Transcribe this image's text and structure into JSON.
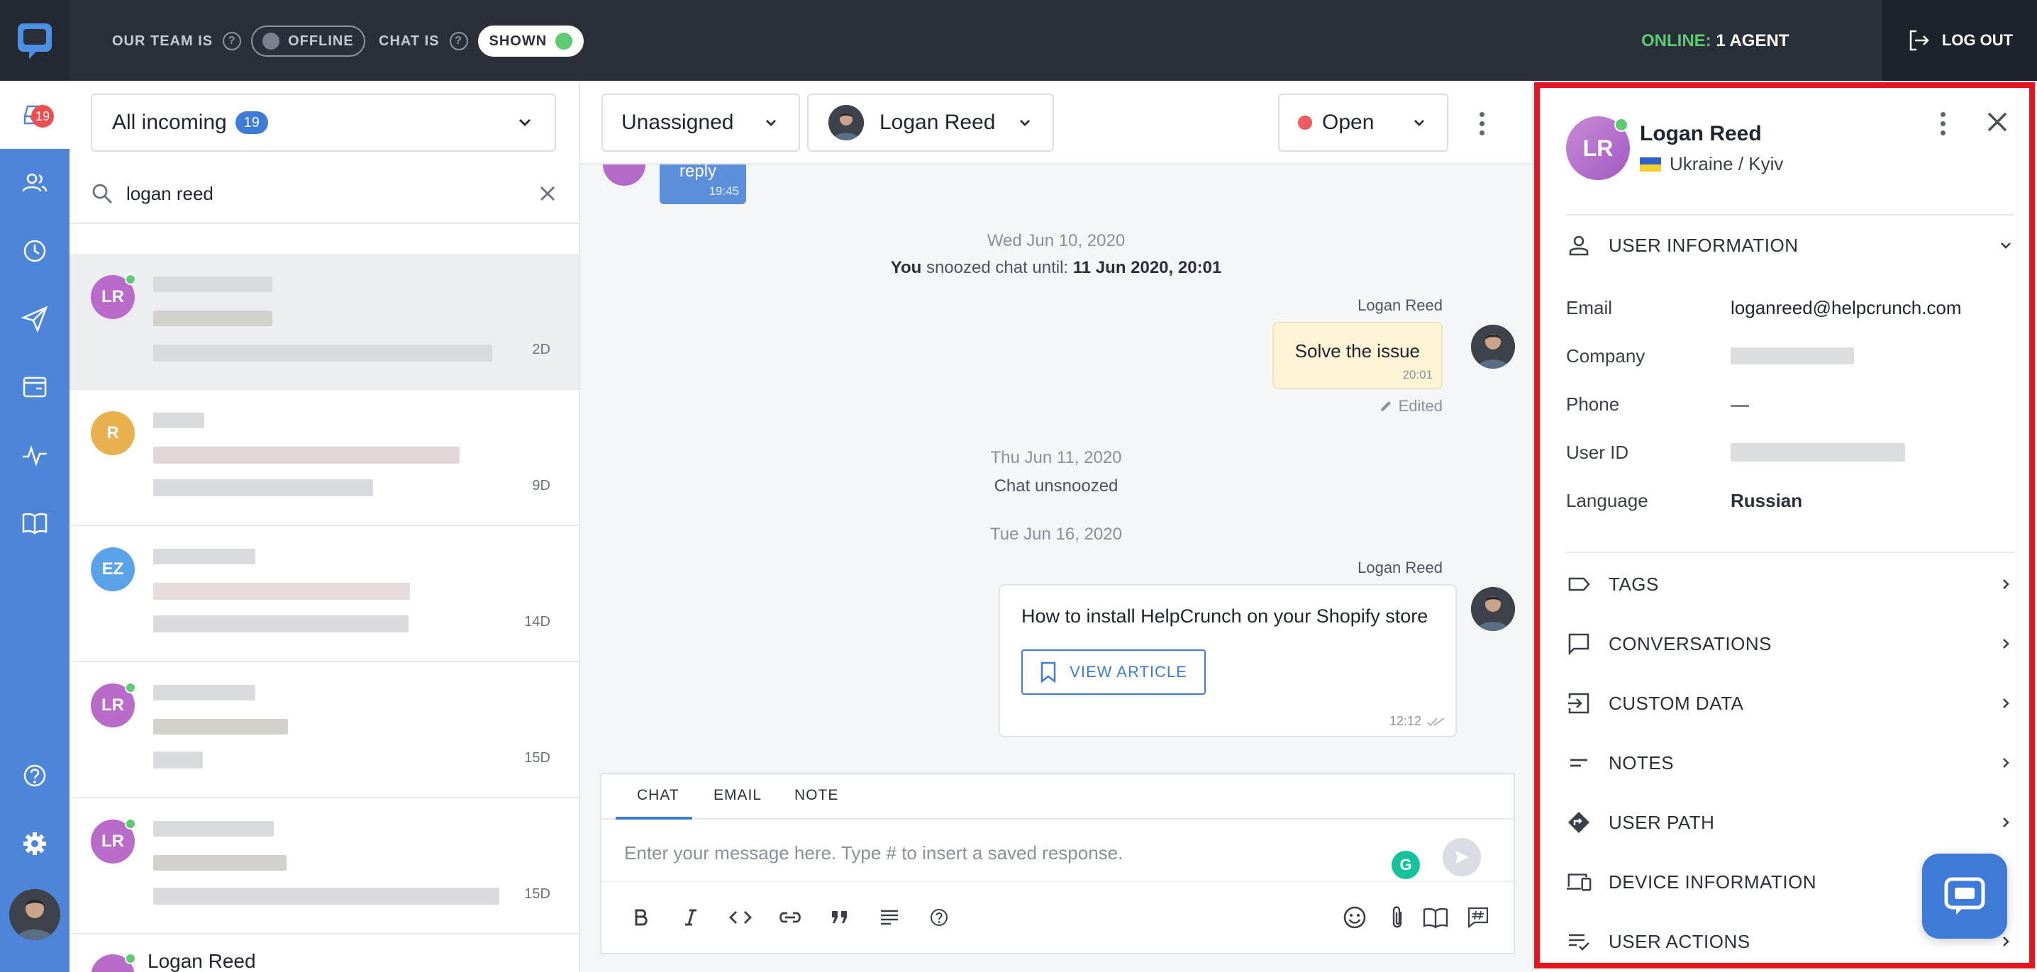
{
  "topbar": {
    "team_label": "OUR TEAM IS",
    "team_status": "OFFLINE",
    "chat_label": "CHAT IS",
    "chat_status": "SHOWN",
    "online_label": "ONLINE:",
    "online_count": "1 AGENT",
    "logout_label": "LOG OUT",
    "online_color": "#5ccb73"
  },
  "leftnav": {
    "inbox_badge": "19",
    "items": [
      "inbox-icon",
      "users-icon",
      "clock-icon",
      "send-icon",
      "wallet-icon",
      "activity-icon",
      "book-icon",
      "help-icon",
      "gear-icon"
    ]
  },
  "list": {
    "inbox_title": "All incoming",
    "inbox_count": "19",
    "search_value": "logan reed",
    "items": [
      {
        "initials": "LR",
        "time": "2D",
        "color": "#b86bc9",
        "online": true
      },
      {
        "initials": "R",
        "time": "9D",
        "color": "#e9b04e",
        "online": false
      },
      {
        "initials": "EZ",
        "time": "14D",
        "color": "#5aa3e8",
        "online": false
      },
      {
        "initials": "LR",
        "time": "15D",
        "color": "#b86bc9",
        "online": true
      },
      {
        "initials": "LR",
        "time": "15D",
        "color": "#b86bc9",
        "online": true
      }
    ],
    "last_name": "Logan Reed"
  },
  "chat": {
    "assign_label": "Unassigned",
    "agent_name": "Logan Reed",
    "status_label": "Open",
    "prev_bubble_text": "reply",
    "prev_bubble_time": "19:45",
    "date1": "Wed Jun 10, 2020",
    "snooze_you": "You",
    "snooze_text": "snoozed chat until:",
    "snooze_date": "11 Jun 2020, 20:01",
    "author1": "Logan Reed",
    "note_text": "Solve the issue",
    "note_time": "20:01",
    "edited_label": "Edited",
    "date2": "Thu Jun 11, 2020",
    "unsnoozed": "Chat unsnoozed",
    "date3": "Tue Jun 16, 2020",
    "author2": "Logan Reed",
    "card_title": "How to install HelpCrunch on your Shopify store",
    "card_button": "VIEW ARTICLE",
    "card_time": "12:12"
  },
  "composer": {
    "tabs": [
      "CHAT",
      "EMAIL",
      "NOTE"
    ],
    "placeholder": "Enter your message here. Type # to insert a saved response.",
    "grammarly": "G"
  },
  "profile": {
    "initials": "LR",
    "name": "Logan Reed",
    "location": "Ukraine / Kyiv",
    "user_info_title": "USER INFORMATION",
    "rows": [
      {
        "key": "Email",
        "value": "loganreed@helpcrunch.com"
      },
      {
        "key": "Company",
        "value": ""
      },
      {
        "key": "Phone",
        "value": "—"
      },
      {
        "key": "User ID",
        "value": ""
      },
      {
        "key": "Language",
        "value": "Russian"
      }
    ],
    "sections": [
      "TAGS",
      "CONVERSATIONS",
      "CUSTOM DATA",
      "NOTES",
      "USER PATH",
      "DEVICE INFORMATION",
      "USER ACTIONS"
    ]
  }
}
